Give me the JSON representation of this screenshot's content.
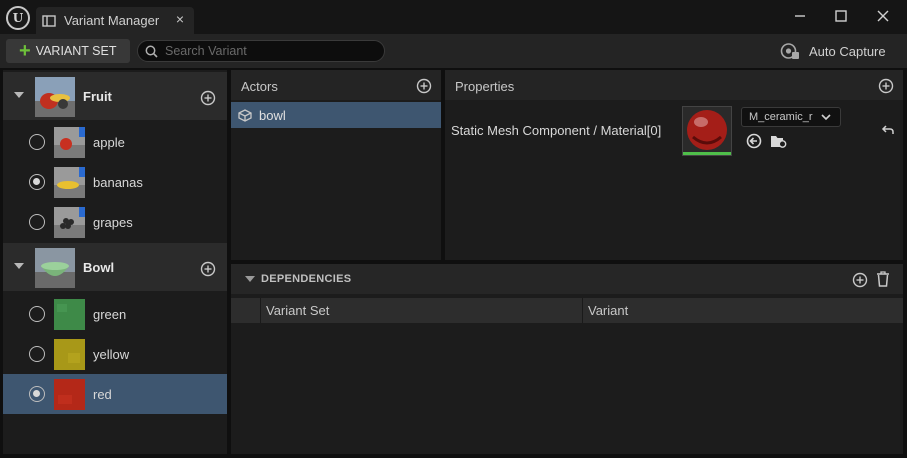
{
  "window": {
    "tab_title": "Variant Manager",
    "tab_close": "×"
  },
  "toolbar": {
    "add_variant_set_label": "VARIANT SET",
    "search_placeholder": "Search Variant",
    "auto_capture_label": "Auto Capture"
  },
  "variant_sets": [
    {
      "name": "Fruit",
      "variants": [
        {
          "label": "apple",
          "selected": false
        },
        {
          "label": "bananas",
          "selected": true
        },
        {
          "label": "grapes",
          "selected": false
        }
      ]
    },
    {
      "name": "Bowl",
      "variants": [
        {
          "label": "green",
          "selected": false
        },
        {
          "label": "yellow",
          "selected": false
        },
        {
          "label": "red",
          "selected": true
        }
      ]
    }
  ],
  "actors": {
    "title": "Actors",
    "items": [
      {
        "label": "bowl"
      }
    ]
  },
  "properties": {
    "title": "Properties",
    "property_label": "Static Mesh Component / Material[0]",
    "material_value": "M_ceramic_r"
  },
  "dependencies": {
    "title": "DEPENDENCIES",
    "columns": [
      "Variant Set",
      "Variant"
    ]
  },
  "colors": {
    "accent_selection": "#3e5670",
    "add_green": "#6ec13a",
    "material_bar": "#4fbf4a"
  }
}
